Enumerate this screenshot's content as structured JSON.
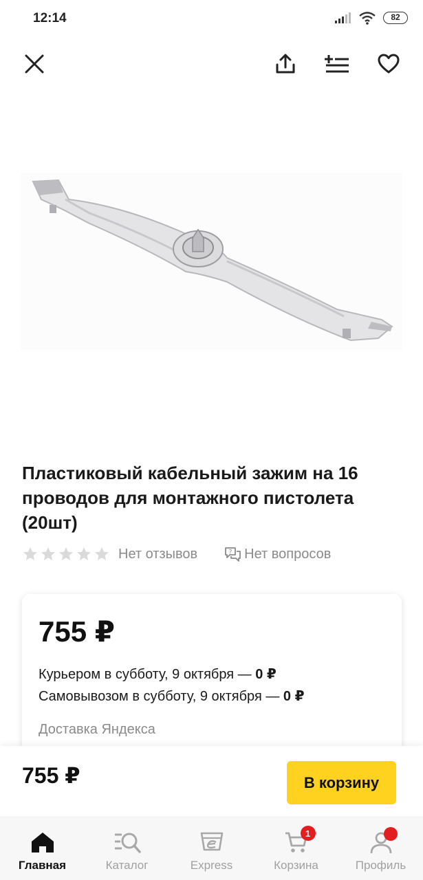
{
  "status_bar": {
    "time": "12:14",
    "battery": "82"
  },
  "product": {
    "title": "Пластиковый кабельный зажим на 16 проводов для монтажного пистолета (20шт)",
    "reviews": "Нет отзывов",
    "questions": "Нет вопросов",
    "rating_stars": 5,
    "rating_filled": 0
  },
  "offer": {
    "price": "755 ₽",
    "delivery": [
      {
        "text": "Курьером в субботу, 9 октября — ",
        "price": "0 ₽"
      },
      {
        "text": "Самовывозом в субботу, 9 октября — ",
        "price": "0 ₽"
      }
    ],
    "provider": "Доставка Яндекса"
  },
  "buy_bar": {
    "price": "755 ₽",
    "cart_button": "В корзину"
  },
  "tabs": [
    {
      "label": "Главная",
      "icon": "home-icon",
      "active": true
    },
    {
      "label": "Каталог",
      "icon": "catalog-search-icon",
      "active": false
    },
    {
      "label": "Express",
      "icon": "express-icon",
      "active": false
    },
    {
      "label": "Корзина",
      "icon": "cart-icon",
      "active": false,
      "badge": "1"
    },
    {
      "label": "Профиль",
      "icon": "profile-icon",
      "active": false
    }
  ],
  "colors": {
    "accent_yellow": "#ffd21f",
    "badge_red": "#e31e1e",
    "muted_text": "#8a8a8a"
  }
}
